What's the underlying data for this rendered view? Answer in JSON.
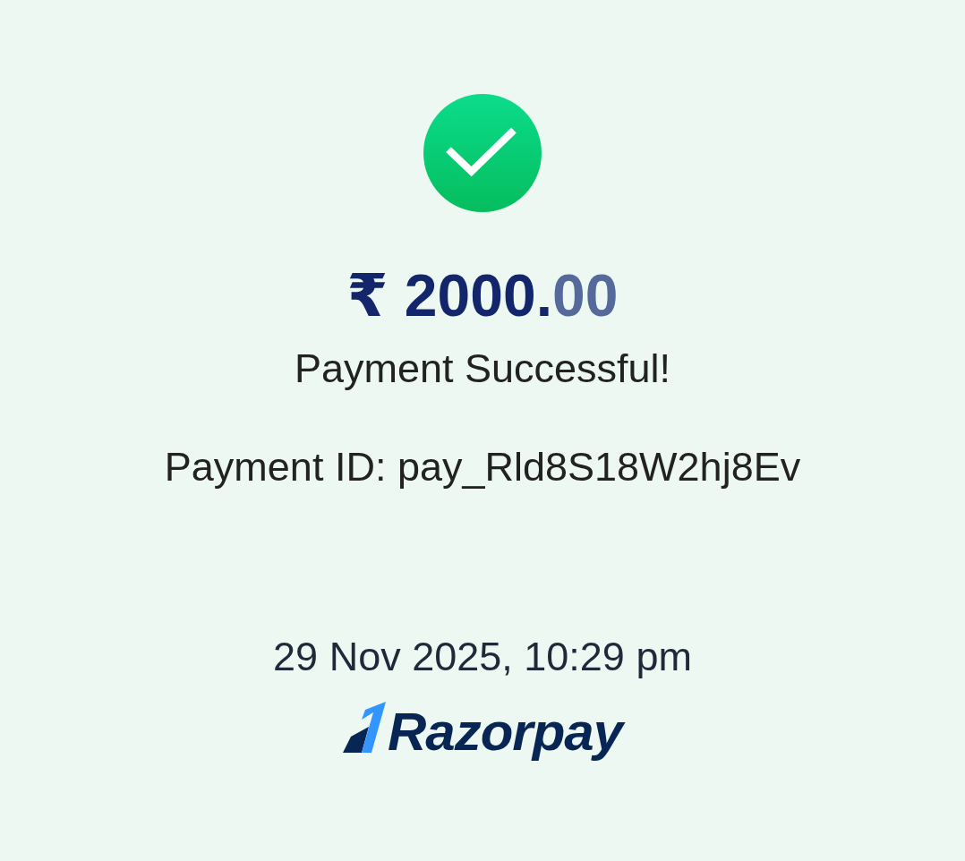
{
  "status": {
    "kind": "success"
  },
  "amount": {
    "main": "₹ 2000.",
    "fraction": "00"
  },
  "message": "Payment Successful!",
  "payment_id": "Payment ID: pay_Rld8S18W2hj8Ev",
  "timestamp": "29 Nov 2025, 10:29 pm",
  "brand": {
    "name": "Razorpay"
  }
}
